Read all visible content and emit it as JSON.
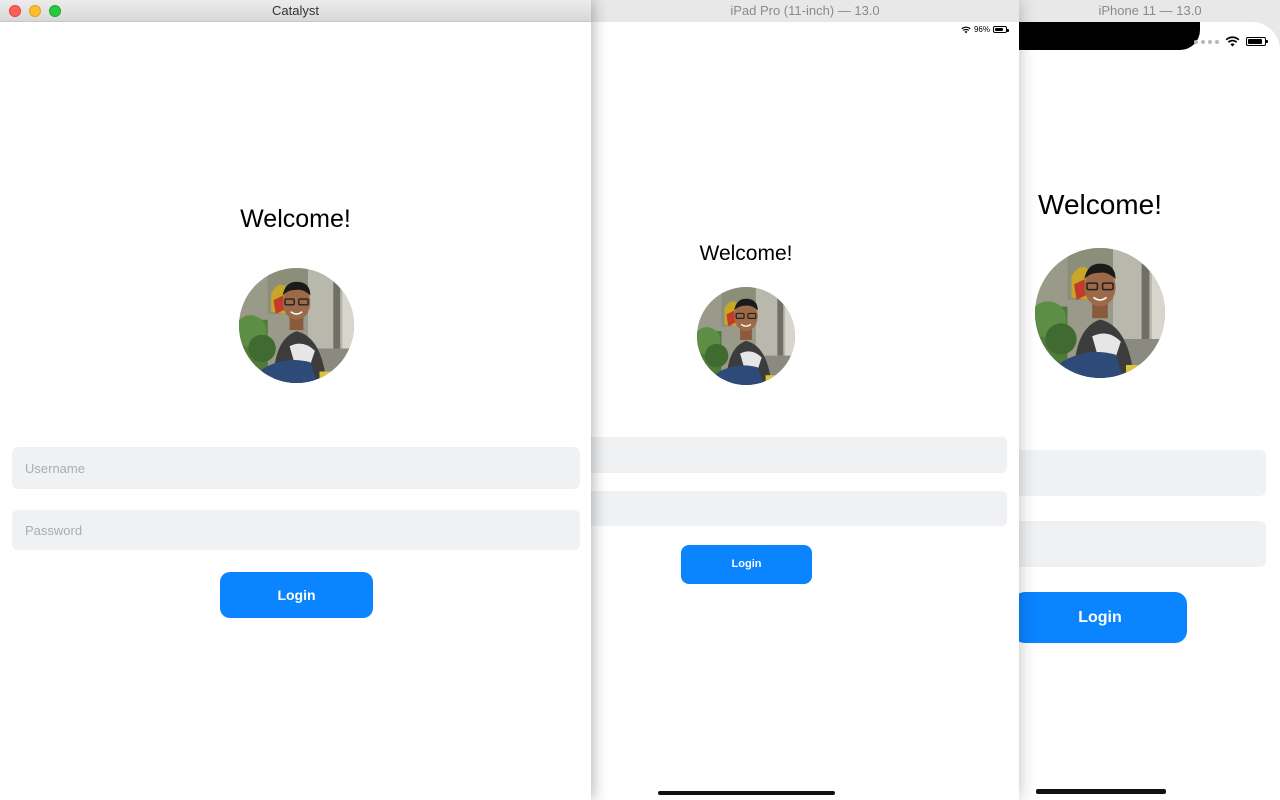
{
  "windows": {
    "catalyst": {
      "title": "Catalyst",
      "welcome": "Welcome!",
      "username_placeholder": "Username",
      "password_placeholder": "Password",
      "login_label": "Login"
    },
    "ipad": {
      "title": "iPad Pro (11-inch) — 13.0",
      "battery_text": "96%",
      "welcome": "Welcome!",
      "login_label": "Login"
    },
    "iphone": {
      "title": "iPhone 11 — 13.0",
      "welcome": "Welcome!",
      "login_label": "Login"
    }
  },
  "icons": [
    "wifi-icon",
    "battery-icon",
    "signal-dots-icon"
  ],
  "colors": {
    "accent": "#0a84ff",
    "field_bg": "#eff1f3",
    "placeholder": "#a9adb2"
  }
}
